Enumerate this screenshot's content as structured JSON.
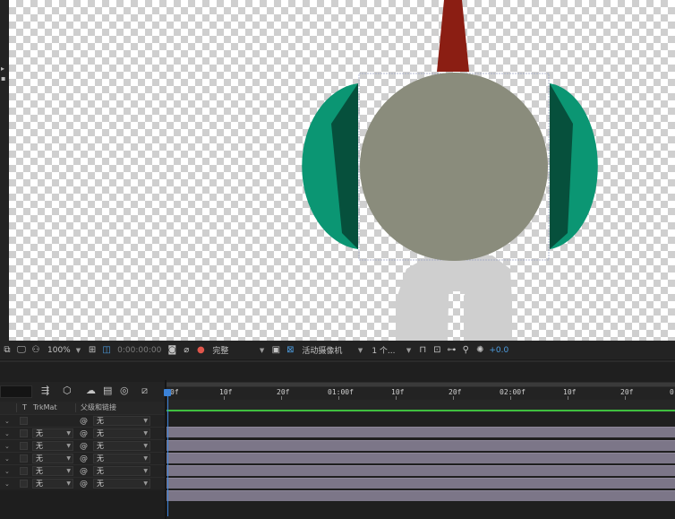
{
  "viewer_toolbar": {
    "icons_left": [
      "region-of-interest-icon",
      "monitor-icon",
      "mask-view-icon"
    ],
    "zoom": "100%",
    "grid_icon": "grid-icon",
    "region_icon": "toggle-transparency-icon",
    "timecode": "0:00:00:00",
    "snapshot_icon": "camera-icon",
    "channel_icon": "color-channels-icon",
    "resolution": "完整",
    "fast_preview_icon": "fast-preview-icon",
    "transparency_grid_icon": "transparency-grid-icon",
    "camera": "活动摄像机",
    "views": "1 个...",
    "right_icons": [
      "reset-exposure-icon",
      "layout-icon",
      "flowchart-icon",
      "3d-draft-icon"
    ],
    "exposure_icon": "exposure-icon",
    "exposure_value": "+0.0"
  },
  "timeline": {
    "columns": {
      "t": "T",
      "trkmat": "TrkMat",
      "parent": "父级和链接"
    },
    "rows": [
      {
        "trkmat": "",
        "parent": "无"
      },
      {
        "trkmat": "无",
        "parent": "无"
      },
      {
        "trkmat": "无",
        "parent": "无"
      },
      {
        "trkmat": "无",
        "parent": "无"
      },
      {
        "trkmat": "无",
        "parent": "无"
      },
      {
        "trkmat": "无",
        "parent": "无"
      }
    ],
    "ruler_ticks": [
      "0f",
      "10f",
      "20f",
      "01:00f",
      "10f",
      "20f",
      "02:00f",
      "10f",
      "20f",
      "0"
    ],
    "control_icons": [
      "composition-mini-flowchart-icon",
      "draft-3d-icon",
      "shy-layers-icon",
      "frame-blending-icon",
      "motion-blur-icon",
      "graph-editor-icon"
    ]
  },
  "colors": {
    "head": "#8a8c7c",
    "hat_spike": "#8b1e13",
    "ear_teal": "#0b9673",
    "ear_dark": "#06503c",
    "legs": "#cfcfcf",
    "track": "#7c7688",
    "accent": "#4d9de0"
  }
}
